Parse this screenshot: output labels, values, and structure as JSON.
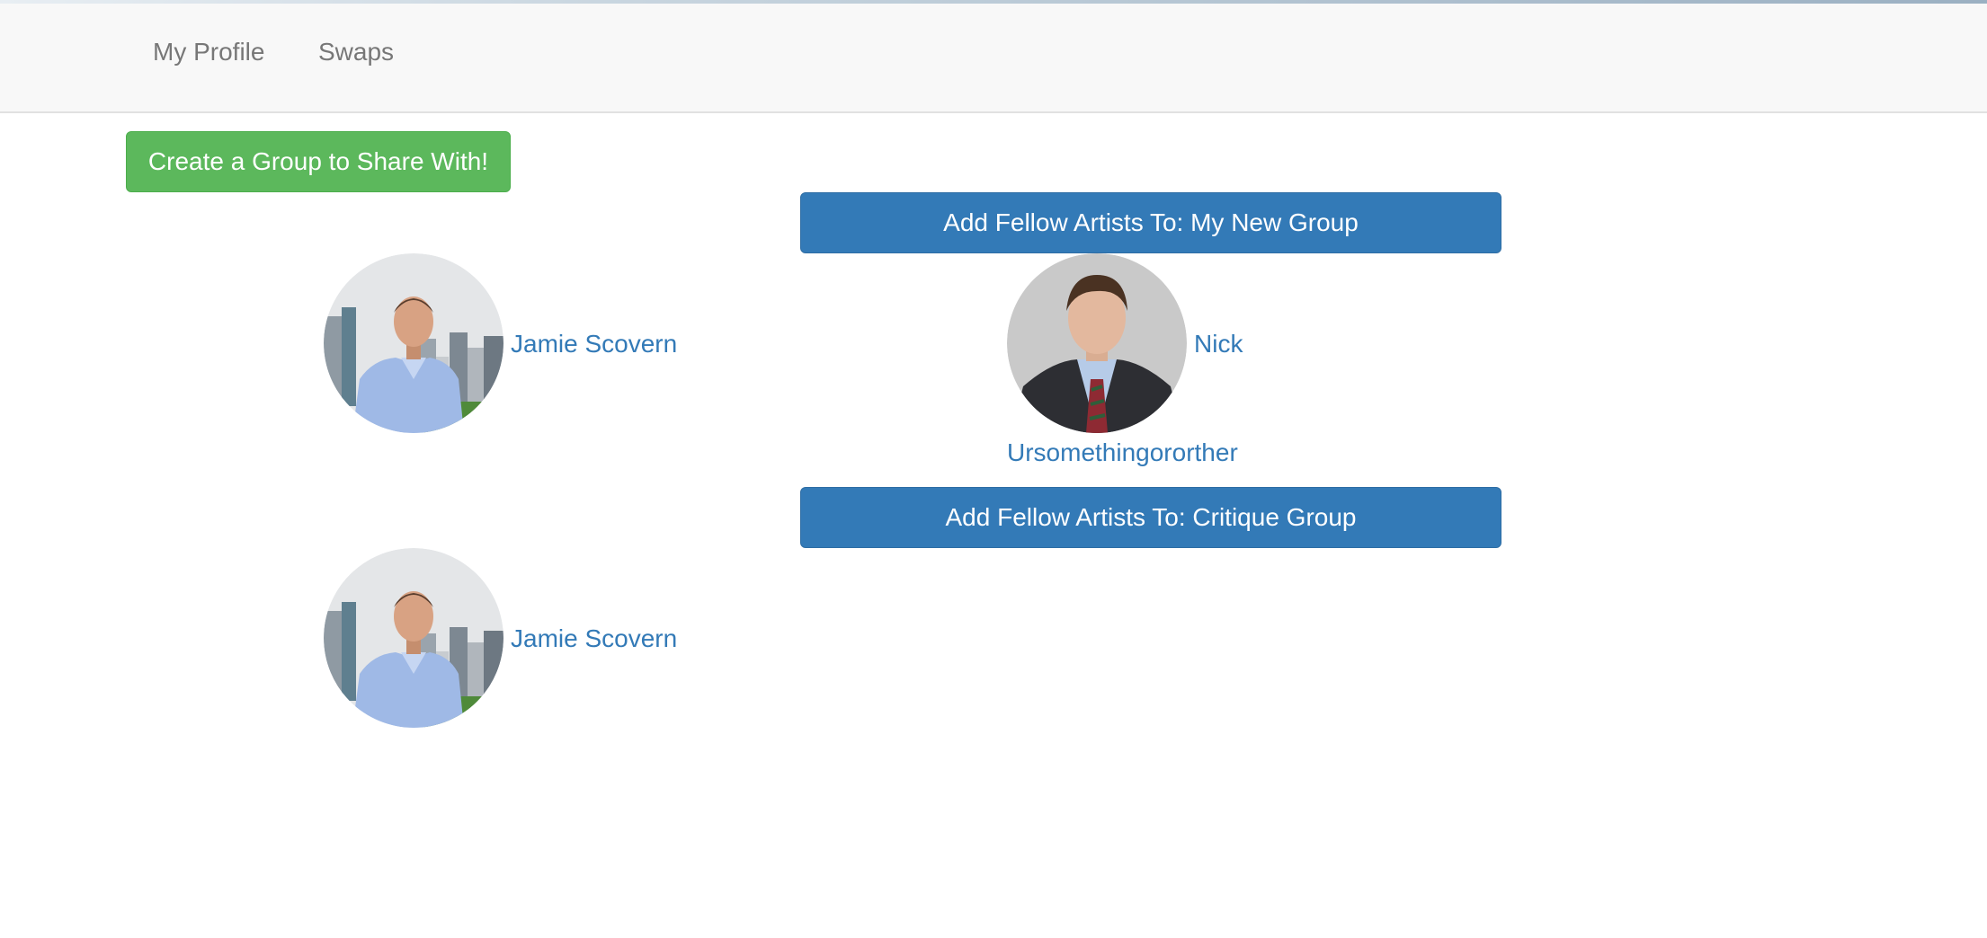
{
  "nav": {
    "items": [
      "My Profile",
      "Swaps"
    ]
  },
  "actions": {
    "create_group_label": "Create a Group to Share With!"
  },
  "groups": [
    {
      "button_label": "Add Fellow Artists To: My New Group",
      "members": [
        {
          "name": "Jamie Scovern",
          "avatar": "man-smiling-city-skyline-photo"
        },
        {
          "name": "Nick",
          "name_line2": "Ursomethingororther",
          "avatar": "man-suit-portrait-photo"
        }
      ]
    },
    {
      "button_label": "Add Fellow Artists To: Critique Group",
      "members": [
        {
          "name": "Jamie Scovern",
          "avatar": "man-smiling-city-skyline-photo"
        }
      ]
    }
  ],
  "colors": {
    "success": "#5cb85c",
    "primary": "#337ab7",
    "link": "#337ab7",
    "nav_bg": "#f8f8f8",
    "nav_text": "#777777"
  }
}
